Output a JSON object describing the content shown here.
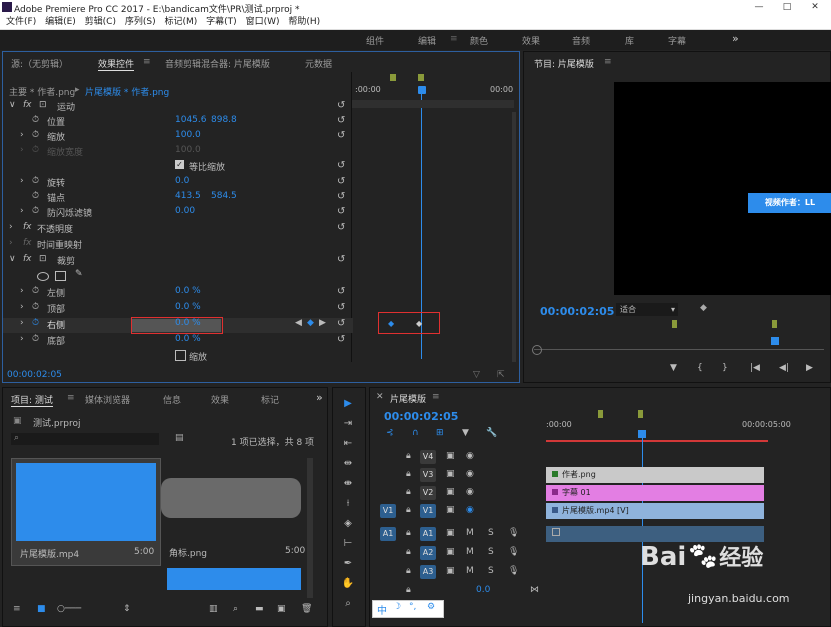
{
  "window": {
    "title": "Adobe Premiere Pro CC 2017 - E:\\bandicam文件\\PR\\测试.prproj *",
    "minimize": "—",
    "maximize": "□",
    "close": "✕"
  },
  "menu": [
    "文件(F)",
    "编辑(E)",
    "剪辑(C)",
    "序列(S)",
    "标记(M)",
    "字幕(T)",
    "窗口(W)",
    "帮助(H)"
  ],
  "workspaces": [
    "组件",
    "编辑",
    "颜色",
    "效果",
    "音频",
    "库",
    "字幕"
  ],
  "workspaces_more": "»",
  "effects_panel": {
    "tabs": [
      "源:（无剪辑）",
      "效果控件",
      "音频剪辑混合器: 片尾模版",
      "元数据"
    ],
    "master_label": "主要 * 作者.png",
    "clip_label": "片尾模版 * 作者.png",
    "ruler_time_left": ":00:00",
    "ruler_time_right": "00:00",
    "rows": [
      {
        "label": "运动",
        "value": "",
        "value2": ""
      },
      {
        "label": "位置",
        "value": "1045.6",
        "value2": "898.8"
      },
      {
        "label": "缩放",
        "value": "100.0",
        "value2": ""
      },
      {
        "label": "缩放宽度",
        "value": "100.0",
        "value2": ""
      },
      {
        "label": "等比缩放",
        "value": "",
        "value2": ""
      },
      {
        "label": "旋转",
        "value": "0.0",
        "value2": ""
      },
      {
        "label": "锚点",
        "value": "413.5",
        "value2": "584.5"
      },
      {
        "label": "防闪烁滤镜",
        "value": "0.00",
        "value2": ""
      },
      {
        "label": "不透明度",
        "value": "",
        "value2": ""
      },
      {
        "label": "时间重映射",
        "value": "",
        "value2": ""
      },
      {
        "label": "裁剪",
        "value": "",
        "value2": ""
      },
      {
        "label": "左侧",
        "value": "0.0 %",
        "value2": ""
      },
      {
        "label": "顶部",
        "value": "0.0 %",
        "value2": ""
      },
      {
        "label": "右侧",
        "value": "0.0 %",
        "value2": ""
      },
      {
        "label": "底部",
        "value": "0.0 %",
        "value2": ""
      },
      {
        "label": "缩放",
        "value": "",
        "value2": ""
      }
    ],
    "timecode": "00:00:02:05"
  },
  "program_monitor": {
    "title": "节目: 片尾模版",
    "overlay_text": "视频作者：LL",
    "timecode": "00:00:02:05",
    "fit": "适合"
  },
  "project_panel": {
    "tabs": [
      "项目: 测试",
      "媒体浏览器",
      "信息",
      "效果",
      "标记"
    ],
    "more": "»",
    "file": "测试.prproj",
    "selection_info": "1 项已选择，共 8 项",
    "items": [
      {
        "name": "片尾模版.mp4",
        "duration": "5:00"
      },
      {
        "name": "角标.png",
        "duration": "5:00"
      }
    ]
  },
  "timeline": {
    "title": "片尾模版",
    "timecode": "00:00:02:05",
    "ruler": [
      ":00:00",
      "00:00:05:00"
    ],
    "video_tracks": [
      "V4",
      "V3",
      "V2",
      "V1"
    ],
    "audio_tracks": [
      "A1",
      "A2",
      "A3"
    ],
    "source_v": "V1",
    "source_a": "A1",
    "master_value": "0.0",
    "clips": [
      {
        "name": "作者.png",
        "color": "#c9c9c9"
      },
      {
        "name": "字幕 01",
        "color": "#e37ee3"
      },
      {
        "name": "片尾模版.mp4 [V]",
        "color": "#8fb3dc"
      }
    ]
  },
  "watermark": {
    "brand": "Bai",
    "brand2": "经验",
    "url": "jingyan.baidu.com"
  },
  "ime": {
    "label": "中"
  },
  "colors": {
    "accent": "#2d8ceb",
    "highlight": "#e03030"
  }
}
